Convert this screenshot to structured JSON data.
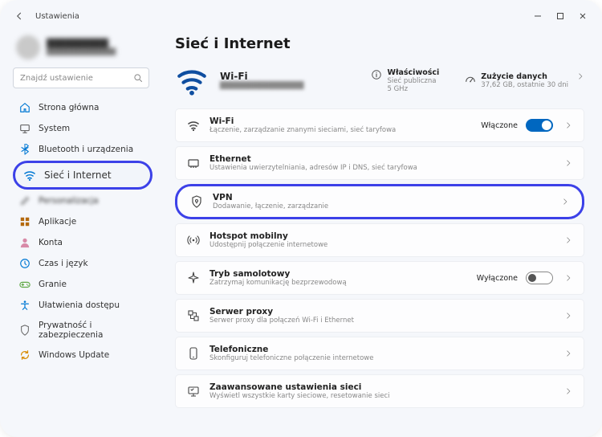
{
  "app_title": "Ustawienia",
  "account": {
    "name": "██████████",
    "mail": "██████████████"
  },
  "search": {
    "placeholder": "Znajdź ustawienie"
  },
  "sidebar": {
    "items": [
      {
        "label": "Strona główna",
        "icon": "home"
      },
      {
        "label": "System",
        "icon": "system"
      },
      {
        "label": "Bluetooth i urządzenia",
        "icon": "bluetooth"
      },
      {
        "label": "Sieć i Internet",
        "icon": "wifi",
        "highlight": true
      },
      {
        "label": "Personalizacja",
        "icon": "brush",
        "blurred": true
      },
      {
        "label": "Aplikacje",
        "icon": "apps"
      },
      {
        "label": "Konta",
        "icon": "account"
      },
      {
        "label": "Czas i język",
        "icon": "clock"
      },
      {
        "label": "Granie",
        "icon": "gaming"
      },
      {
        "label": "Ułatwienia dostępu",
        "icon": "accessibility"
      },
      {
        "label": "Prywatność i zabezpieczenia",
        "icon": "privacy"
      },
      {
        "label": "Windows Update",
        "icon": "update"
      }
    ]
  },
  "page": {
    "title": "Sieć i Internet",
    "summary": {
      "wifi_title": "Wi-Fi",
      "wifi_sub": "████████████████",
      "props": {
        "title": "Właściwości",
        "sub": "Sieć publiczna\n5 GHz"
      },
      "usage": {
        "title": "Zużycie danych",
        "sub": "37,62 GB, ostatnie 30 dni"
      }
    },
    "cards": [
      {
        "icon": "wifi",
        "title": "Wi-Fi",
        "sub": "Łączenie, zarządzanie znanymi sieciami, sieć taryfowa",
        "state_label": "Włączone",
        "toggle": "on"
      },
      {
        "icon": "ethernet",
        "title": "Ethernet",
        "sub": "Ustawienia uwierzytelniania, adresów IP i DNS, sieć taryfowa"
      },
      {
        "icon": "shield",
        "title": "VPN",
        "sub": "Dodawanie, łączenie, zarządzanie",
        "highlight": true
      },
      {
        "icon": "hotspot",
        "title": "Hotspot mobilny",
        "sub": "Udostępnij połączenie internetowe"
      },
      {
        "icon": "airplane",
        "title": "Tryb samolotowy",
        "sub": "Zatrzymaj komunikację bezprzewodową",
        "state_label": "Wyłączone",
        "toggle": "off"
      },
      {
        "icon": "proxy",
        "title": "Serwer proxy",
        "sub": "Serwer proxy dla połączeń Wi-Fi i Ethernet"
      },
      {
        "icon": "dialup",
        "title": "Telefoniczne",
        "sub": "Skonfiguruj telefoniczne połączenie internetowe"
      },
      {
        "icon": "advanced",
        "title": "Zaawansowane ustawienia sieci",
        "sub": "Wyświetl wszystkie karty sieciowe, resetowanie sieci"
      }
    ]
  },
  "icons": {
    "home": "#0078d4",
    "bluetooth": "#0078d4",
    "wifi": "#0078d4",
    "apps": "#b4690e",
    "account": "#d88aa8",
    "clock": "#0078d4",
    "gaming": "#5fa845",
    "accessibility": "#0078d4",
    "privacy": "#6a6a6a",
    "update": "#d88c00"
  }
}
